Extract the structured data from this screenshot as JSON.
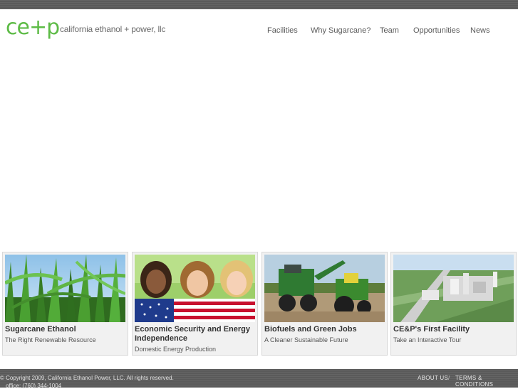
{
  "header": {
    "logo_mark": "ce+p",
    "logo_text": "california ethanol + power, llc"
  },
  "nav": {
    "items": [
      {
        "label": "Facilities"
      },
      {
        "label": "Why Sugarcane?"
      },
      {
        "label": "Team"
      },
      {
        "label": "Opportunities"
      },
      {
        "label": "News"
      }
    ]
  },
  "cards": [
    {
      "title": "Sugarcane Ethanol",
      "subtitle": "The Right Renewable Resource"
    },
    {
      "title": "Economic Security and Energy Independence",
      "subtitle": "Domestic Energy Production"
    },
    {
      "title": "Biofuels and Green Jobs",
      "subtitle": "A Cleaner Sustainable Future"
    },
    {
      "title": "CE&P's First Facility",
      "subtitle": "Take an Interactive Tour"
    }
  ],
  "footer": {
    "copyright": "© Copyright 2009, California Ethanol Power, LLC. All rights reserved.",
    "office": "office: (760) 344-1004",
    "about_label": "ABOUT US",
    "separator": "/",
    "terms_label": "TERMS & CONDITIONS"
  },
  "colors": {
    "brand_green": "#5dbb46",
    "bar_gray": "#5a5a5a"
  }
}
